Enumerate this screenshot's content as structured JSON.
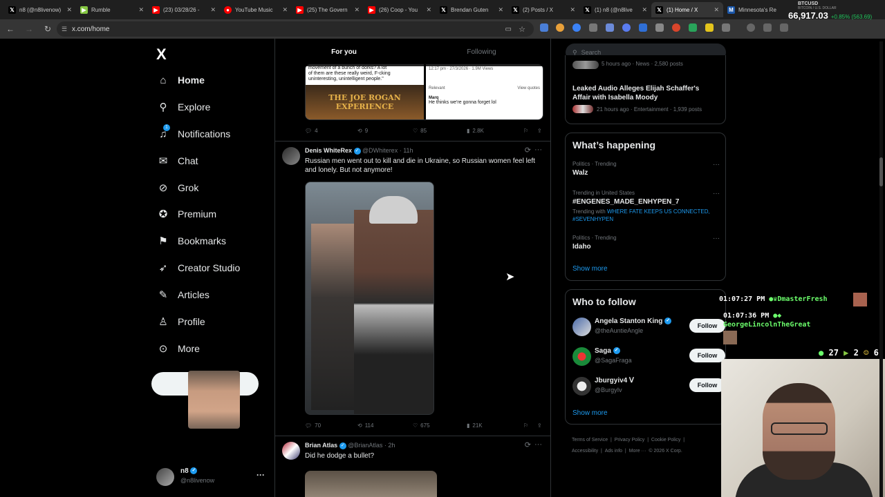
{
  "browser": {
    "tabs": [
      {
        "label": "n8 (@n8livenow)",
        "favicon": "x-icon",
        "color": "#000000"
      },
      {
        "label": "Rumble",
        "favicon": "rumble-icon",
        "color": "#85c742"
      },
      {
        "label": "(23) 03/28/26 -",
        "favicon": "youtube-icon",
        "color": "#ff0000"
      },
      {
        "label": "YouTube Music",
        "favicon": "youtube-music-icon",
        "color": "#ff0000"
      },
      {
        "label": "(25) The Govern",
        "favicon": "youtube-icon",
        "color": "#ff0000"
      },
      {
        "label": "(26) Coop - You",
        "favicon": "youtube-icon",
        "color": "#ff0000"
      },
      {
        "label": "Brendan Guten",
        "favicon": "x-icon",
        "color": "#000000"
      },
      {
        "label": "(2) Posts / X",
        "favicon": "x-icon",
        "color": "#000000"
      },
      {
        "label": "(1) n8 (@n8live",
        "favicon": "x-icon",
        "color": "#000000"
      },
      {
        "label": "(1) Home / X",
        "favicon": "x-icon",
        "color": "#000000"
      },
      {
        "label": "Minnesota's Re",
        "favicon": "site-icon",
        "color": "#1a56a8"
      }
    ],
    "url": "x.com/home",
    "ticker": {
      "symbol": "BTCUSD",
      "name": "BITCOIN / U.S. DOLLAR",
      "price": "66,917.03",
      "change": "+0.85% (563.69)"
    }
  },
  "sidebar": {
    "logo": "X",
    "items": [
      {
        "label": "Home",
        "icon": "home-icon",
        "glyph": "⌂"
      },
      {
        "label": "Explore",
        "icon": "search-icon",
        "glyph": "⚲"
      },
      {
        "label": "Notifications",
        "icon": "bell-icon",
        "glyph": "🔔"
      },
      {
        "label": "Chat",
        "icon": "mail-icon",
        "glyph": "✉"
      },
      {
        "label": "Grok",
        "icon": "grok-icon",
        "glyph": "⊘"
      },
      {
        "label": "Premium",
        "icon": "premium-icon",
        "glyph": "✪"
      },
      {
        "label": "Bookmarks",
        "icon": "bookmark-icon",
        "glyph": "⚑"
      },
      {
        "label": "Creator Studio",
        "icon": "rocket-icon",
        "glyph": "➶"
      },
      {
        "label": "Articles",
        "icon": "article-icon",
        "glyph": "✎"
      },
      {
        "label": "Profile",
        "icon": "profile-icon",
        "glyph": "♙"
      },
      {
        "label": "More",
        "icon": "more-icon",
        "glyph": "⋯"
      }
    ],
    "notifications_badge": "1",
    "user": {
      "name": "n8",
      "handle": "@n8livenow",
      "more": "···"
    }
  },
  "feed": {
    "tabs": [
      "For you",
      "Following"
    ],
    "prev_tweet": {
      "media_text_left": "movement of a bunch of dorks? A lot of them are these really weird, F-cking uninteresting, unintelligent people.\"",
      "media_brand": "THE JOE ROGAN EXPERIENCE",
      "media_meta_right": "12:17 pm · 27/3/2026 · 1.9M Views",
      "media_reply_name": "Marq",
      "media_reply_text": "He thinks we're gonna forget lol",
      "media_relevant": "Relevant",
      "media_view_quotes": "View quotes",
      "replies": "4",
      "reposts": "9",
      "likes": "85",
      "views": "2.8K"
    },
    "tweets": [
      {
        "name": "Denis WhiteRex",
        "handle": "@DWhiterex",
        "time": "· 11h",
        "text": "Russian men went out to kill and die in Ukraine, so Russian women feel left and lonely. But not anymore!",
        "replies": "70",
        "reposts": "114",
        "likes": "675",
        "views": "21K"
      },
      {
        "name": "Brian Atlas",
        "handle": "@BrianAtlas",
        "time": "· 2h",
        "text": "Did he dodge a bullet?"
      }
    ]
  },
  "right": {
    "search_placeholder": "Search",
    "trending_partial": {
      "meta": "5 hours ago · News · 2,580 posts"
    },
    "story": {
      "title": "Leaked Audio Alleges Elijah Schaffer's Affair with Isabella Moody",
      "meta": "21 hours ago · Entertainment · 1,939 posts"
    },
    "happening_title": "What’s happening",
    "trends": [
      {
        "meta": "Politics · Trending",
        "name": "Walz",
        "with": ""
      },
      {
        "meta": "Trending in United States",
        "name": "#ENGENES_MADE_ENHYPEN_7",
        "with_label": "Trending with",
        "with": "WHERE FATE KEEPS US CONNECTED, #SEVENHYPEN"
      },
      {
        "meta": "Politics · Trending",
        "name": "Idaho",
        "with": ""
      }
    ],
    "show_more": "Show more",
    "who_title": "Who to follow",
    "who": [
      {
        "name": "Angela Stanton King",
        "handle": "@theAuntieAngle",
        "button": "Follow",
        "verified": true
      },
      {
        "name": "Saga",
        "handle": "@SagaFraga",
        "button": "Follow",
        "verified": true
      },
      {
        "name": "Jburgyiv4 ᐯ",
        "handle": "@BurgyIv",
        "button": "Follow",
        "verified": false
      }
    ],
    "footer": [
      "Terms of Service",
      "|",
      "Privacy Policy",
      "|",
      "Cookie Policy",
      "|",
      "Accessibility",
      "|",
      "Ads info",
      "|",
      "More ···",
      "© 2026 X Corp."
    ]
  },
  "overlay": {
    "chat": [
      {
        "time": "01:07:27 PM",
        "user": "DmasterFresh"
      },
      {
        "time": "01:07:36 PM",
        "user": "GeorgeLincolnTheGreat"
      }
    ],
    "stats": {
      "viewers": "27",
      "rumble": "2",
      "emoji": "6"
    }
  }
}
